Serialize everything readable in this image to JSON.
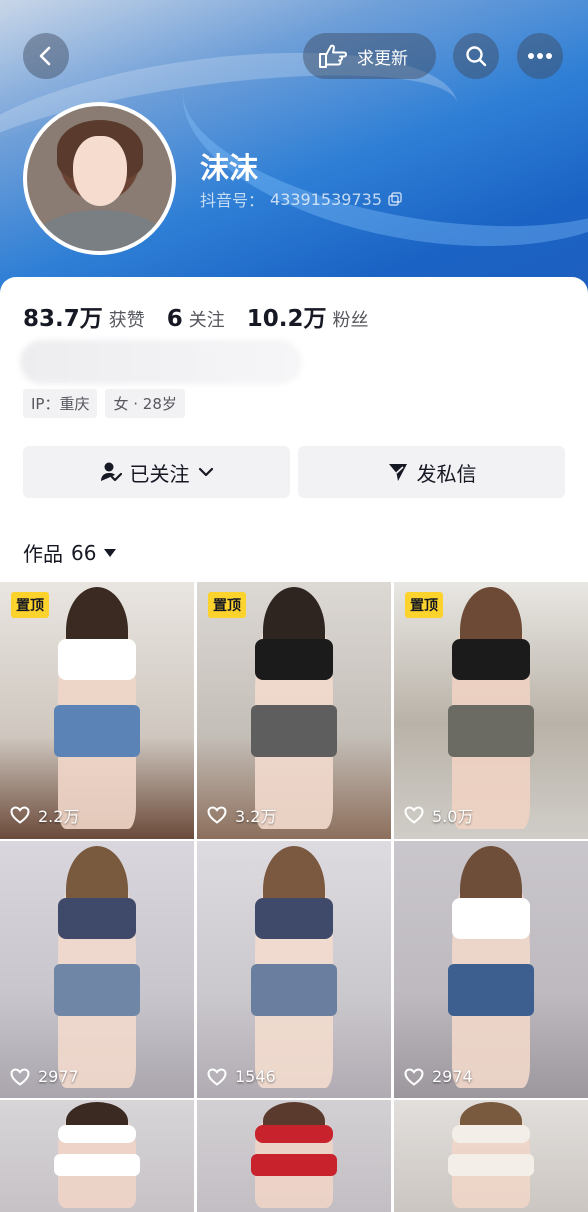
{
  "header": {
    "update_label": "求更新",
    "icons": {
      "back": "chevron-left-icon",
      "hand": "pointing-hand-icon",
      "search": "search-icon",
      "more": "more-dots-icon",
      "copy": "copy-icon"
    }
  },
  "profile": {
    "name": "沫沫",
    "id_label": "抖音号：",
    "id_value": "43391539735"
  },
  "stats": [
    {
      "num": "83.7万",
      "label": "获赞"
    },
    {
      "num": "6",
      "label": "关注"
    },
    {
      "num": "10.2万",
      "label": "粉丝"
    }
  ],
  "tags": [
    "IP：重庆",
    "女 · 28岁"
  ],
  "actions": {
    "follow_label": "已关注",
    "message_label": "发私信"
  },
  "works": {
    "label": "作品",
    "count": "66"
  },
  "pin_label": "置顶",
  "videos": [
    {
      "pinned": true,
      "likes": "2.2万"
    },
    {
      "pinned": true,
      "likes": "3.2万"
    },
    {
      "pinned": true,
      "likes": "5.0万"
    },
    {
      "pinned": false,
      "likes": "2977"
    },
    {
      "pinned": false,
      "likes": "1546"
    },
    {
      "pinned": false,
      "likes": "2974"
    },
    {
      "pinned": false,
      "likes": ""
    },
    {
      "pinned": false,
      "likes": ""
    },
    {
      "pinned": false,
      "likes": ""
    }
  ],
  "colors": {
    "accent_pin": "#fcd22c",
    "header_blue": "#2f7fd6",
    "button_gray": "#f2f2f4"
  }
}
